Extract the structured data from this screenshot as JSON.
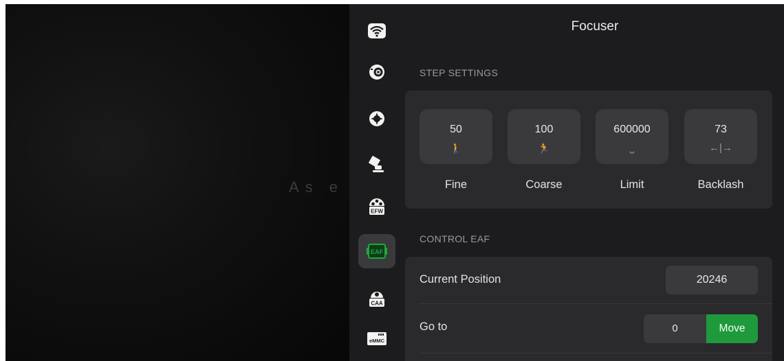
{
  "background": {
    "text": "As e"
  },
  "sidebar": {
    "items": [
      {
        "icon": "wifi-icon"
      },
      {
        "icon": "camera-lens-icon"
      },
      {
        "icon": "guide-target-icon"
      },
      {
        "icon": "telescope-mount-icon"
      },
      {
        "icon": "filter-wheel-icon",
        "badge": "EFW"
      },
      {
        "icon": "focuser-icon",
        "badge": "EAF",
        "active": true
      },
      {
        "icon": "rotator-icon",
        "badge": "CAA"
      },
      {
        "icon": "storage-icon",
        "badge": "eMMC"
      }
    ],
    "active_color": "#1fa83c"
  },
  "header": {
    "title": "Focuser"
  },
  "step_settings": {
    "section_title": "STEP SETTINGS",
    "items": [
      {
        "value": "50",
        "icon": "walking-person-icon",
        "glyph": "🚶",
        "label": "Fine"
      },
      {
        "value": "100",
        "icon": "running-person-icon",
        "glyph": "🏃",
        "label": "Coarse"
      },
      {
        "value": "600000",
        "icon": "range-limit-icon",
        "glyph": "⎵",
        "label": "Limit"
      },
      {
        "value": "73",
        "icon": "backlash-arrows-icon",
        "glyph": "←|→",
        "label": "Backlash"
      }
    ]
  },
  "control": {
    "section_title": "CONTROL EAF",
    "current_position_label": "Current Position",
    "current_position_value": "20246",
    "goto_label": "Go to",
    "goto_value": "0",
    "move_label": "Move",
    "move_color": "#1e9a3c"
  }
}
